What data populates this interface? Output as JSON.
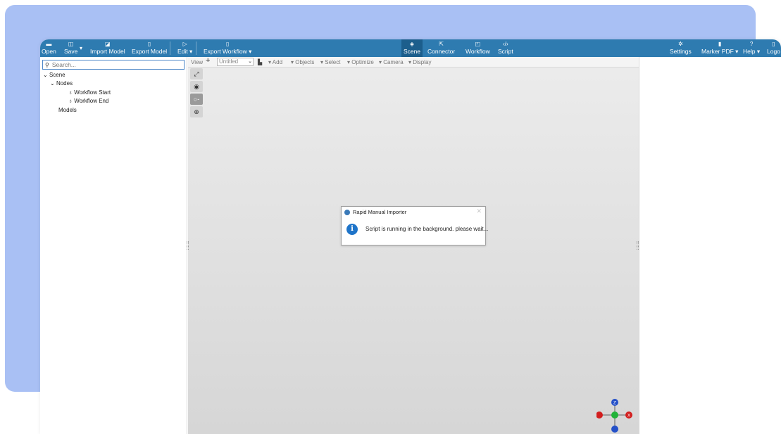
{
  "colors": {
    "toolbar": "#2e7bb0",
    "accent_bg": "#a9c0f4",
    "active_tab": "#1c5e8c"
  },
  "toolbar": {
    "open": "Open",
    "save": "Save",
    "import_model": "Import Model",
    "export_model": "Export Model",
    "edit": "Edit ▾",
    "export_workflow": "Export Workflow ▾",
    "scene": "Scene",
    "connector": "Connector",
    "workflow": "Workflow",
    "script": "Script",
    "settings": "Settings",
    "marker_pdf": "Marker PDF ▾",
    "help": "Help ▾",
    "logout": "Logo"
  },
  "search": {
    "placeholder": "Search..."
  },
  "tree": {
    "scene": "Scene",
    "nodes": "Nodes",
    "workflow_start": "Workflow Start",
    "workflow_end": "Workflow End",
    "models": "Models"
  },
  "viewport_toolbar": {
    "view": "View",
    "plus": "+",
    "scene_select": "Untitled",
    "add": "▾ Add",
    "objects": "▾ Objects",
    "select": "▾ Select",
    "optimize": "▾ Optimize",
    "camera": "▾ Camera",
    "display": "▾ Display"
  },
  "dialog": {
    "title": "Rapid Manual Importer",
    "close": "✕",
    "info": "i",
    "message": "Script is running in the background. please wait..."
  },
  "gizmo": {
    "z": "Z",
    "x": "X"
  }
}
